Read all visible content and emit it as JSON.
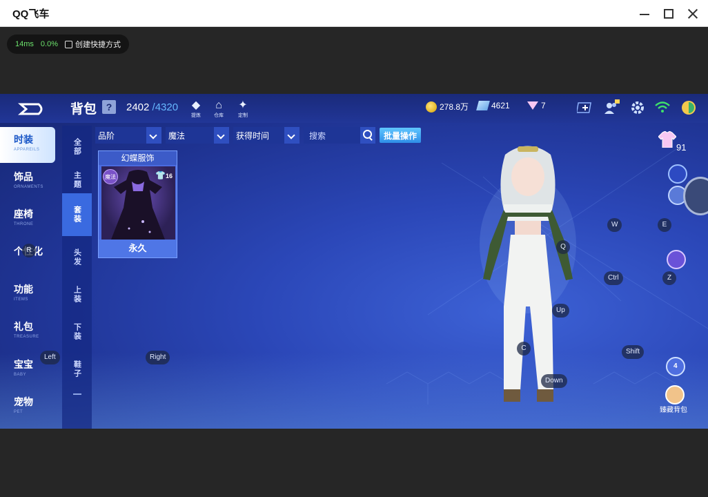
{
  "window": {
    "title": "QQ飞车"
  },
  "overlay": {
    "ping": "14ms",
    "loss": "0.0%",
    "shortcut_label": "创建快捷方式"
  },
  "bag": {
    "title": "背包",
    "help": "?",
    "used": "2402",
    "max": "/4320"
  },
  "top_icons": [
    {
      "label": "提炼",
      "icon": "diamond-icon"
    },
    {
      "label": "仓库",
      "icon": "warehouse-icon"
    },
    {
      "label": "定制",
      "icon": "customize-icon"
    }
  ],
  "currency": {
    "coins": "278.8万",
    "gems": "4621",
    "diamonds": "7"
  },
  "left_nav": [
    {
      "zh": "时装",
      "en": "APPAREILS",
      "active": true
    },
    {
      "zh": "饰品",
      "en": "ORNAMENTS"
    },
    {
      "zh": "座椅",
      "en": "THRONE"
    },
    {
      "zh": "个性化",
      "en": ""
    },
    {
      "zh": "功能",
      "en": "ITEMS"
    },
    {
      "zh": "礼包",
      "en": "TREASURE"
    },
    {
      "zh": "宝宝",
      "en": "BABY"
    },
    {
      "zh": "宠物",
      "en": "PET"
    }
  ],
  "sub_nav": [
    {
      "label": "全部"
    },
    {
      "label": "主题"
    },
    {
      "label": "套装",
      "active": true
    },
    {
      "label": "头发"
    },
    {
      "label": "上装"
    },
    {
      "label": "下装"
    },
    {
      "label": "鞋子"
    }
  ],
  "filters": {
    "quality": "品阶",
    "type": "魔法",
    "sort": "获得时间",
    "search_placeholder": "搜索",
    "batch": "批量操作"
  },
  "item": {
    "name": "幻蝶服饰",
    "badge": "魔法",
    "level": "16",
    "duration": "永久"
  },
  "outfit_count": "91",
  "collect_label": "臻藏背包",
  "key_hints": {
    "r": "R",
    "left": "Left",
    "right": "Right",
    "w": "W",
    "e": "E",
    "q": "Q",
    "ctrl": "Ctrl",
    "z": "Z",
    "up": "Up",
    "c": "C",
    "shift": "Shift",
    "down": "Down"
  },
  "bottom_badge": "4",
  "colors": {
    "accent": "#2f8ee8",
    "capacity_max": "#66b8ff",
    "ping": "#6de36d"
  }
}
